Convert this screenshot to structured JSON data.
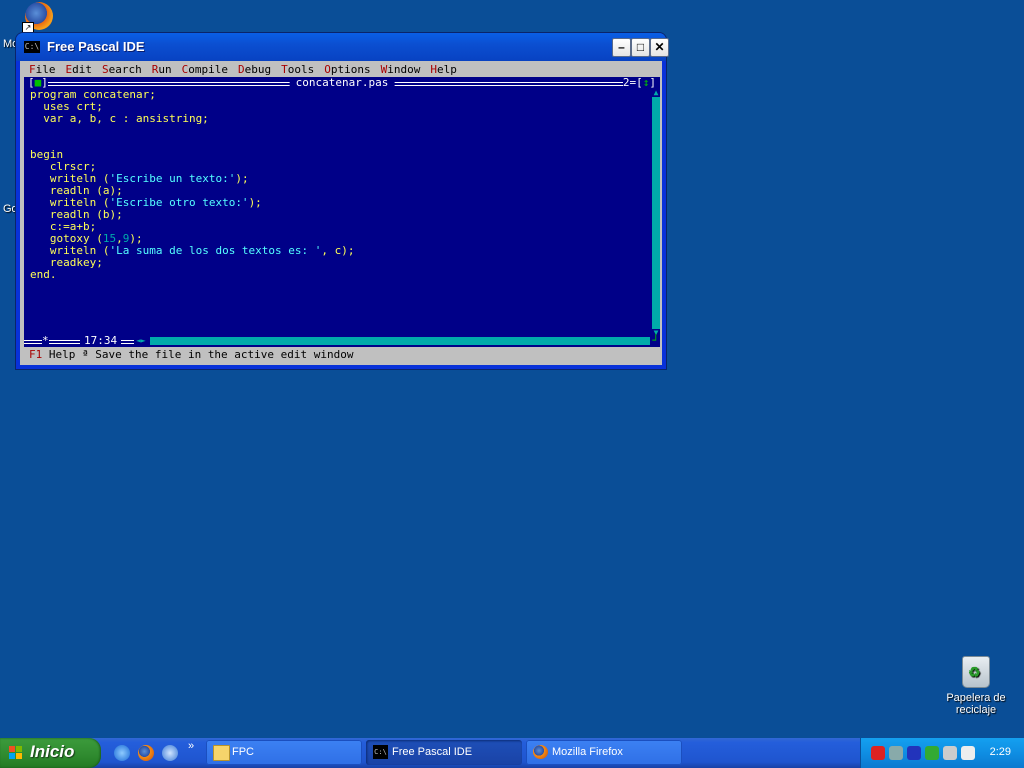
{
  "desktop": {
    "icon_firefox_top": {
      "name": "firefox-shortcut"
    },
    "cut_label_1": "Mo",
    "cut_label_2": "Go",
    "recycle_bin_label": "Papelera de reciclaje"
  },
  "window": {
    "title": "Free Pascal IDE",
    "min_glyph": "–",
    "max_glyph": "□",
    "close_glyph": "✕",
    "sys_icon_text": "C:\\"
  },
  "ide": {
    "menu": [
      {
        "hk": "F",
        "rest": "ile"
      },
      {
        "hk": "E",
        "rest": "dit"
      },
      {
        "hk": "S",
        "rest": "earch"
      },
      {
        "hk": "R",
        "rest": "un"
      },
      {
        "hk": "C",
        "rest": "ompile"
      },
      {
        "hk": "D",
        "rest": "ebug"
      },
      {
        "hk": "T",
        "rest": "ools"
      },
      {
        "hk": "O",
        "rest": "ptions"
      },
      {
        "hk": "W",
        "rest": "indow"
      },
      {
        "hk": "H",
        "rest": "elp"
      }
    ],
    "editor_filename": "concatenar.pas",
    "close_box": "[■]",
    "window_number": "2=[↕]",
    "cursor_position": "17:34",
    "modified_marker": "*",
    "code_lines": [
      "program concatenar;",
      "  uses crt;",
      "  var a, b, c : ansistring;",
      "",
      "",
      "begin",
      "   clrscr;",
      "   writeln ('Escribe un texto:');",
      "   readln (a);",
      "   writeln ('Escribe otro texto:');",
      "   readln (b);",
      "   c:=a+b;",
      "   gotoxy (15,9);",
      "   writeln ('La suma de los dos textos es: ', c);",
      "   readkey;",
      "end."
    ],
    "status_key": "F1",
    "status_text": " Help ª Save the file in the active edit window"
  },
  "taskbar": {
    "start_label": "Inicio",
    "chevron": "»",
    "tasks": [
      {
        "label": "FPC"
      },
      {
        "label": "Free Pascal IDE"
      },
      {
        "label": "Mozilla Firefox"
      }
    ],
    "clock": "2:29"
  },
  "colors": {
    "desktop": "#0a4e97",
    "editor_bg": "#000088",
    "code_text": "#ffff55",
    "string_text": "#55ffff"
  }
}
